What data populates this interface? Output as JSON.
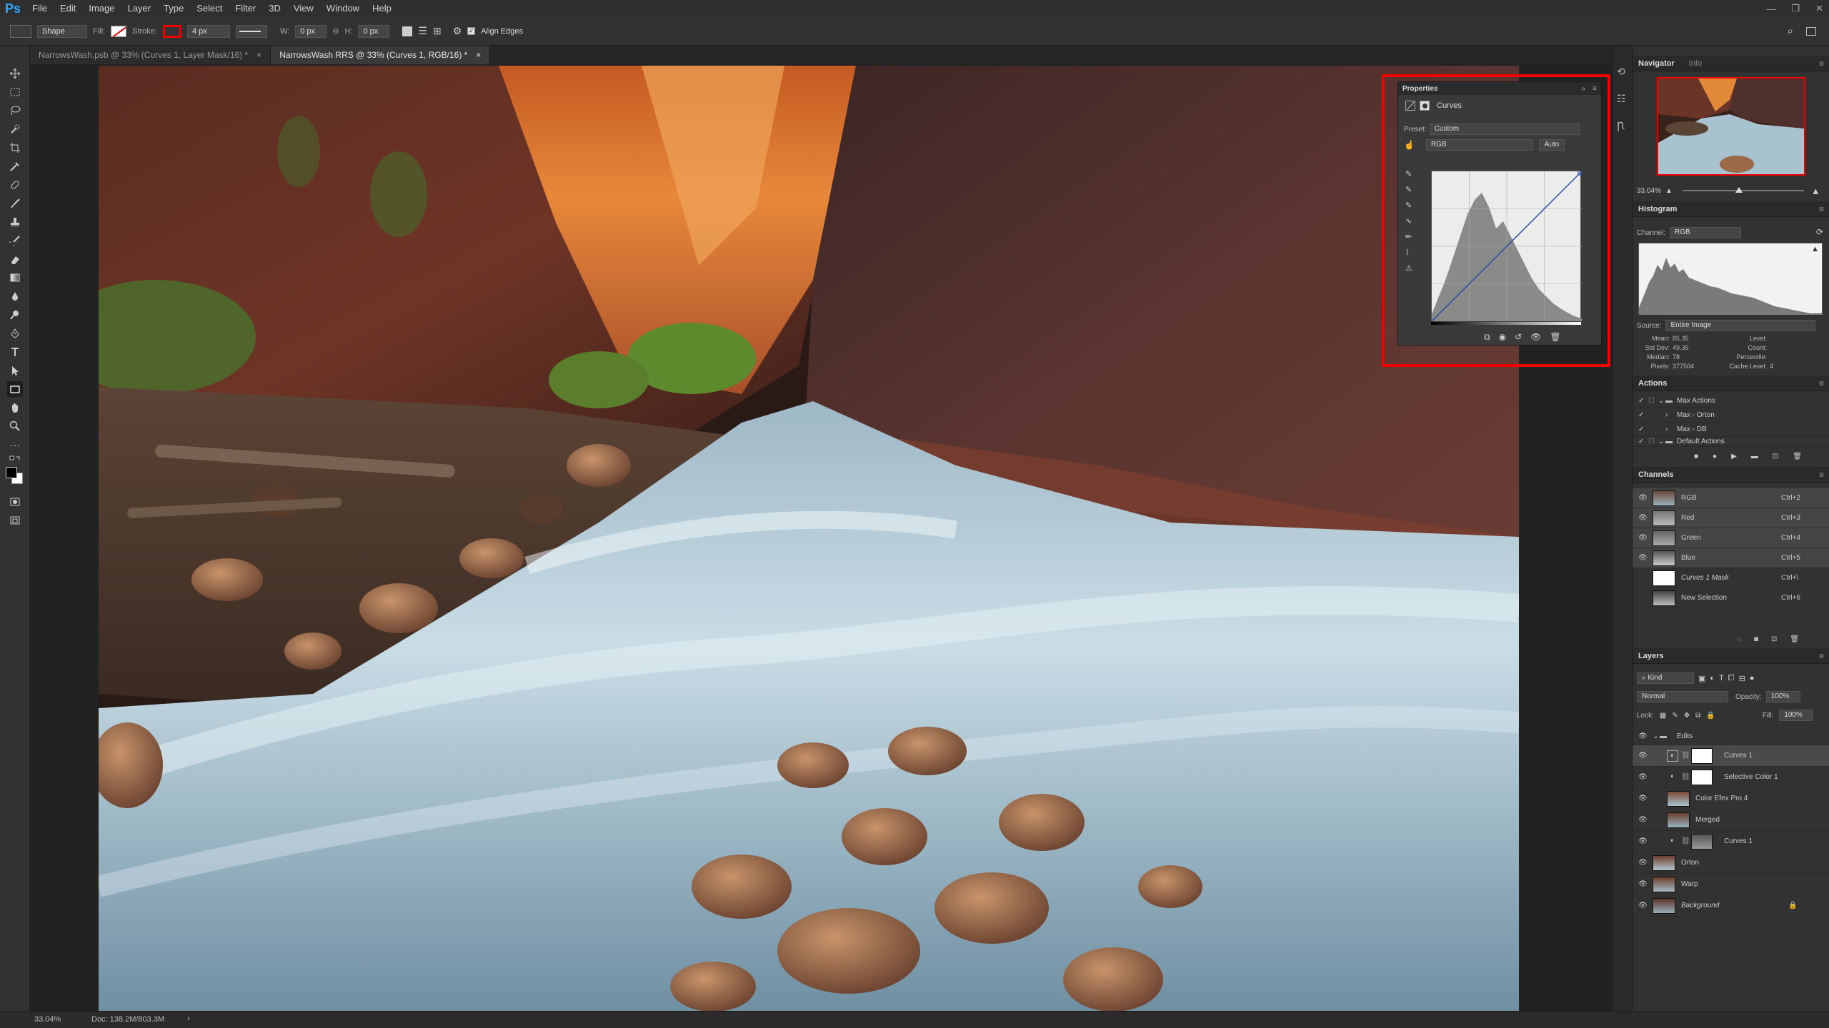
{
  "app": {
    "logo": "Ps"
  },
  "menu": [
    "File",
    "Edit",
    "Image",
    "Layer",
    "Type",
    "Select",
    "Filter",
    "3D",
    "View",
    "Window",
    "Help"
  ],
  "window_controls": [
    "—",
    "❐",
    "✕"
  ],
  "options_bar": {
    "mode": "Shape",
    "fill_label": "Fill:",
    "stroke_label": "Stroke:",
    "stroke_width": "4 px",
    "w_label": "W:",
    "w_value": "0 px",
    "h_label": "H:",
    "h_value": "0 px",
    "align_edges": "Align Edges",
    "align_checked": true
  },
  "tabs": [
    {
      "label": "NarrowsWash.psb @ 33% (Curves 1, Layer Mask/16) *",
      "active": false
    },
    {
      "label": "NarrowsWash RRS @ 33% (Curves 1, RGB/16) *",
      "active": true
    }
  ],
  "status": {
    "zoom": "33.04%",
    "doc": "Doc: 138.2M/803.3M"
  },
  "properties": {
    "title": "Properties",
    "adjustment": "Curves",
    "preset_label": "Preset:",
    "preset_value": "Custom",
    "channel_value": "RGB",
    "auto_label": "Auto"
  },
  "navigator": {
    "tab_active": "Navigator",
    "tab_other": "Info",
    "zoom": "33.04%"
  },
  "histogram": {
    "title": "Histogram",
    "channel_label": "Channel:",
    "channel_value": "RGB",
    "source_label": "Source:",
    "source_value": "Entire Image",
    "stats_left": [
      {
        "label": "Mean:",
        "value": "85.35"
      },
      {
        "label": "Std Dev:",
        "value": "49.35"
      },
      {
        "label": "Median:",
        "value": "78"
      },
      {
        "label": "Pixels:",
        "value": "377504"
      }
    ],
    "stats_right": [
      {
        "label": "Level:",
        "value": ""
      },
      {
        "label": "Count:",
        "value": ""
      },
      {
        "label": "Percentile:",
        "value": ""
      },
      {
        "label": "Cache Level:",
        "value": "4"
      }
    ]
  },
  "actions": {
    "title": "Actions",
    "items": [
      "Max Actions",
      "Max - Orton",
      "Max - DB",
      "Default Actions"
    ]
  },
  "channels": {
    "title": "Channels",
    "items": [
      {
        "name": "RGB",
        "shortcut": "Ctrl+2"
      },
      {
        "name": "Red",
        "shortcut": "Ctrl+3"
      },
      {
        "name": "Green",
        "shortcut": "Ctrl+4"
      },
      {
        "name": "Blue",
        "shortcut": "Ctrl+5"
      },
      {
        "name": "Curves 1 Mask",
        "shortcut": "Ctrl+\\"
      },
      {
        "name": "New Selection",
        "shortcut": "Ctrl+6"
      }
    ]
  },
  "layers": {
    "title": "Layers",
    "kind_label": "Kind",
    "blend_mode": "Normal",
    "opacity_label": "Opacity:",
    "opacity_value": "100%",
    "lock_label": "Lock:",
    "fill_label": "Fill:",
    "fill_value": "100%",
    "items": [
      {
        "name": "Edits",
        "type": "group"
      },
      {
        "name": "Curves 1",
        "type": "adjust-white"
      },
      {
        "name": "Selective Color 1",
        "type": "adjust-white"
      },
      {
        "name": "Color Efex Pro 4",
        "type": "image"
      },
      {
        "name": "Merged",
        "type": "image"
      },
      {
        "name": "Curves 1",
        "type": "adjust-image"
      },
      {
        "name": "Orton",
        "type": "image"
      },
      {
        "name": "Warp",
        "type": "image"
      },
      {
        "name": "Background",
        "type": "image"
      }
    ]
  },
  "colors": {
    "accent_red": "#e00000",
    "ps_blue": "#31a8ff"
  }
}
